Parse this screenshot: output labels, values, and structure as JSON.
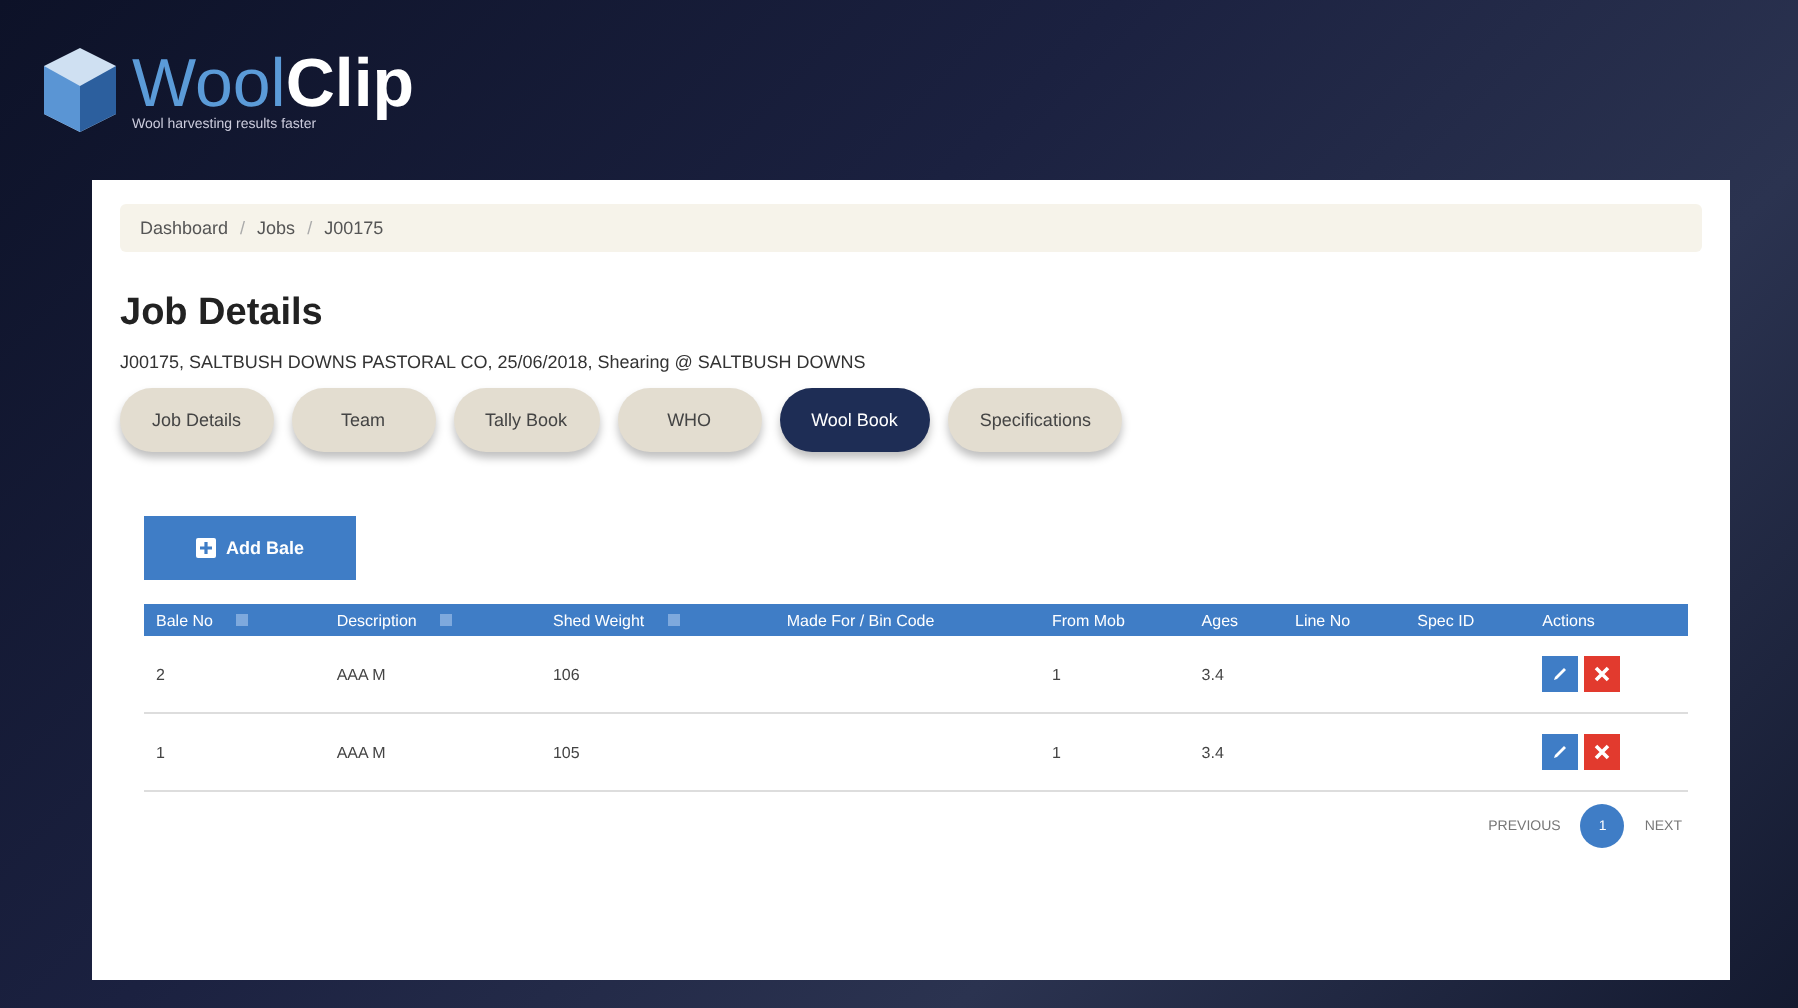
{
  "brand": {
    "name_light": "Wool",
    "name_bold": "Clip",
    "tagline": "Wool harvesting results faster"
  },
  "breadcrumb": [
    {
      "label": "Dashboard",
      "separator": "/"
    },
    {
      "label": "Jobs",
      "separator": "/"
    },
    {
      "label": "J00175"
    }
  ],
  "page": {
    "title": "Job Details",
    "subtitle": "J00175, SALTBUSH DOWNS PASTORAL CO, 25/06/2018, Shearing @ SALTBUSH DOWNS"
  },
  "tabs": [
    {
      "label": "Job Details",
      "selected": false
    },
    {
      "label": "Team",
      "selected": false
    },
    {
      "label": "Tally Book",
      "selected": false
    },
    {
      "label": "WHO",
      "selected": false
    },
    {
      "label": "Wool Book",
      "selected": true
    },
    {
      "label": "Specifications",
      "selected": false
    }
  ],
  "add_button": "Add Bale",
  "table": {
    "columns": [
      {
        "label": "Bale No",
        "sortable": true
      },
      {
        "label": "Description",
        "sortable": true
      },
      {
        "label": "Shed Weight",
        "sortable": true
      },
      {
        "label": "Made For / Bin Code",
        "sortable": false
      },
      {
        "label": "From Mob",
        "sortable": false
      },
      {
        "label": "Ages",
        "sortable": false
      },
      {
        "label": "Line No",
        "sortable": false
      },
      {
        "label": "Spec ID",
        "sortable": false
      },
      {
        "label": "Actions",
        "sortable": false
      }
    ],
    "rows": [
      {
        "cells": [
          "2",
          "AAA M",
          "106",
          "",
          "1",
          "3.4",
          "",
          ""
        ]
      },
      {
        "cells": [
          "1",
          "AAA M",
          "105",
          "",
          "1",
          "3.4",
          "",
          ""
        ]
      }
    ]
  },
  "pagination": {
    "previous": "PREVIOUS",
    "pages": [
      {
        "label": "1",
        "selected": true
      }
    ],
    "next": "NEXT"
  }
}
